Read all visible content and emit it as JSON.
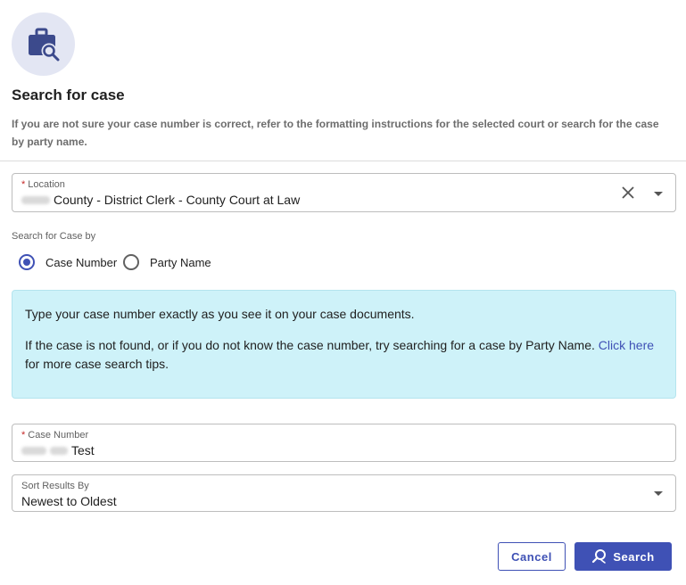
{
  "header": {
    "icon": "briefcase-search-icon",
    "title": "Search for case",
    "subtitle": "If you are not sure your case number is correct, refer to the formatting instructions for the selected court or search for the case by party name."
  },
  "location": {
    "required_mark": "*",
    "label": "Location",
    "value": "County - District Clerk - County Court at Law"
  },
  "search_by": {
    "label": "Search for Case by",
    "options": [
      {
        "label": "Case Number",
        "checked": true
      },
      {
        "label": "Party Name",
        "checked": false
      }
    ]
  },
  "info": {
    "line1": "Type your case number exactly as you see it on your case documents.",
    "line2_text": "If the case is not found, or if you do not know the case number, try searching for a case by Party Name.",
    "link": "Click here",
    "line2_tail": "for more case search tips."
  },
  "case_number": {
    "required_mark": "*",
    "label": "Case Number",
    "value": "Test"
  },
  "sort": {
    "label": "Sort Results By",
    "value": "Newest to Oldest"
  },
  "buttons": {
    "cancel": "Cancel",
    "search": "Search"
  },
  "colors": {
    "primary": "#3f51b5",
    "info_bg": "#cef2f9",
    "icon_circle": "#e3e6f3"
  }
}
